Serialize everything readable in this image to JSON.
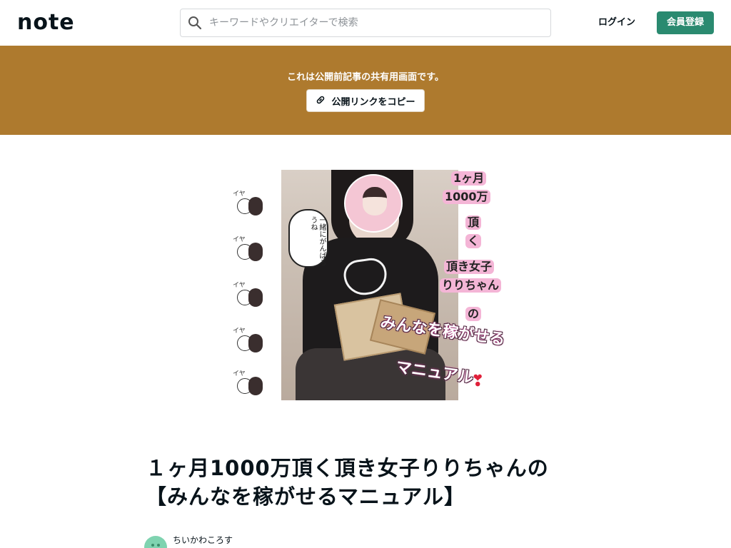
{
  "header": {
    "logo_text": "note",
    "search_placeholder": "キーワードやクリエイターで検索",
    "login_label": "ログイン",
    "register_label": "会員登録"
  },
  "banner": {
    "message": "これは公開前記事の共有用画面です。",
    "copy_link_label": "公開リンクをコピー"
  },
  "hero": {
    "speech_text": "一緒にがんばろうね",
    "side_mark": "イヤ",
    "caption_lines": [
      "1ヶ月",
      "1000万",
      "頂",
      "く",
      "頂き女子",
      "りりちゃん",
      "の"
    ],
    "banner_line1": "みんなを稼がせる",
    "banner_line2": "マニュアル",
    "heart_glyph": "❣"
  },
  "article": {
    "title_line1": "１ヶ月1000万頂く頂き女子りりちゃんの",
    "title_line2": "【みんなを稼がせるマニュアル】",
    "author_name": "ちいかわころす"
  },
  "colors": {
    "banner_bg": "#ae7a2e",
    "register_bg": "#2a8a70",
    "avatar_bg": "#7fd3b0"
  }
}
